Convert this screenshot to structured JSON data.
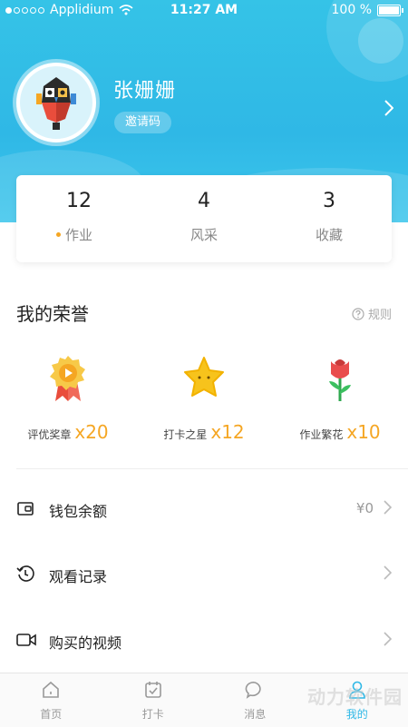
{
  "status_bar": {
    "carrier": "Applidium",
    "time": "11:27 AM",
    "battery": "100 %"
  },
  "profile": {
    "name": "张姗姗",
    "invite_label": "邀请码"
  },
  "stats": [
    {
      "value": "12",
      "label": "作业"
    },
    {
      "value": "4",
      "label": "风采"
    },
    {
      "value": "3",
      "label": "收藏"
    }
  ],
  "honors": {
    "title": "我的荣誉",
    "rules_label": "规则",
    "items": [
      {
        "label": "评优奖章",
        "count": "x20",
        "icon": "medal-icon"
      },
      {
        "label": "打卡之星",
        "count": "x12",
        "icon": "star-icon"
      },
      {
        "label": "作业繁花",
        "count": "x10",
        "icon": "flower-icon"
      }
    ]
  },
  "menu": [
    {
      "label": "钱包余额",
      "value": "¥0",
      "icon": "wallet-icon"
    },
    {
      "label": "观看记录",
      "icon": "history-icon"
    },
    {
      "label": "购买的视频",
      "icon": "video-icon"
    }
  ],
  "tabs": [
    {
      "label": "首页",
      "icon": "home-icon"
    },
    {
      "label": "打卡",
      "icon": "checkin-icon"
    },
    {
      "label": "消息",
      "icon": "message-icon"
    },
    {
      "label": "我的",
      "icon": "profile-icon",
      "active": true
    }
  ],
  "watermark": "动力软件园",
  "colors": {
    "accent": "#2fb8e6",
    "gold": "#f5a623",
    "header": "#35c3e7"
  }
}
